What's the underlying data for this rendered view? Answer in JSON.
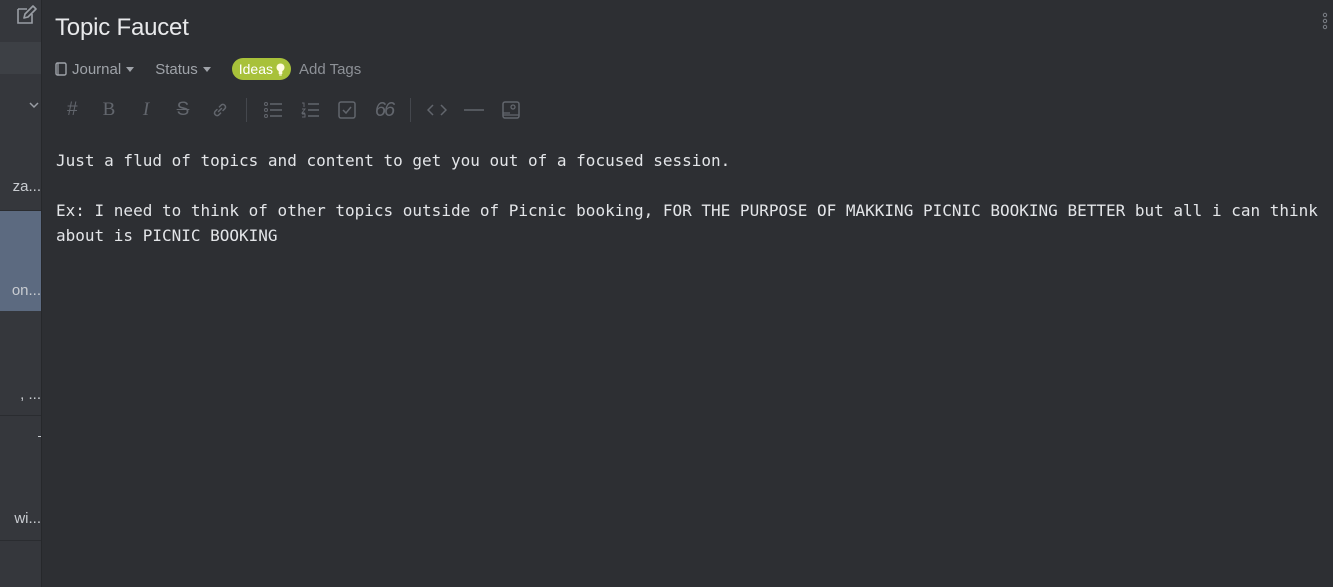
{
  "list_pane": {
    "fragments": [
      "za...",
      "on...",
      ", ...",
      "wi..."
    ],
    "selected_color": "#5c6a80"
  },
  "note": {
    "title": "Topic Faucet",
    "notebook": "Journal",
    "status": "Status",
    "tag": {
      "label": "Ideas",
      "color": "#a8c13a",
      "icon": "lightbulb-icon"
    },
    "add_tags": "Add Tags",
    "toolbar_icons": [
      "heading-icon",
      "bold-icon",
      "italic-icon",
      "strikethrough-icon",
      "link-icon",
      "bulleted-list-icon",
      "numbered-list-icon",
      "checkbox-icon",
      "quote-icon",
      "code-icon",
      "horizontal-rule-icon",
      "image-icon"
    ],
    "paragraphs": [
      "Just a flud of topics and content to get you out of a focused session.",
      "Ex: I need to think of other topics outside of Picnic booking, FOR THE PURPOSE OF MAKKING PICNIC BOOKING BETTER but all i can think about is PICNIC BOOKING"
    ]
  }
}
